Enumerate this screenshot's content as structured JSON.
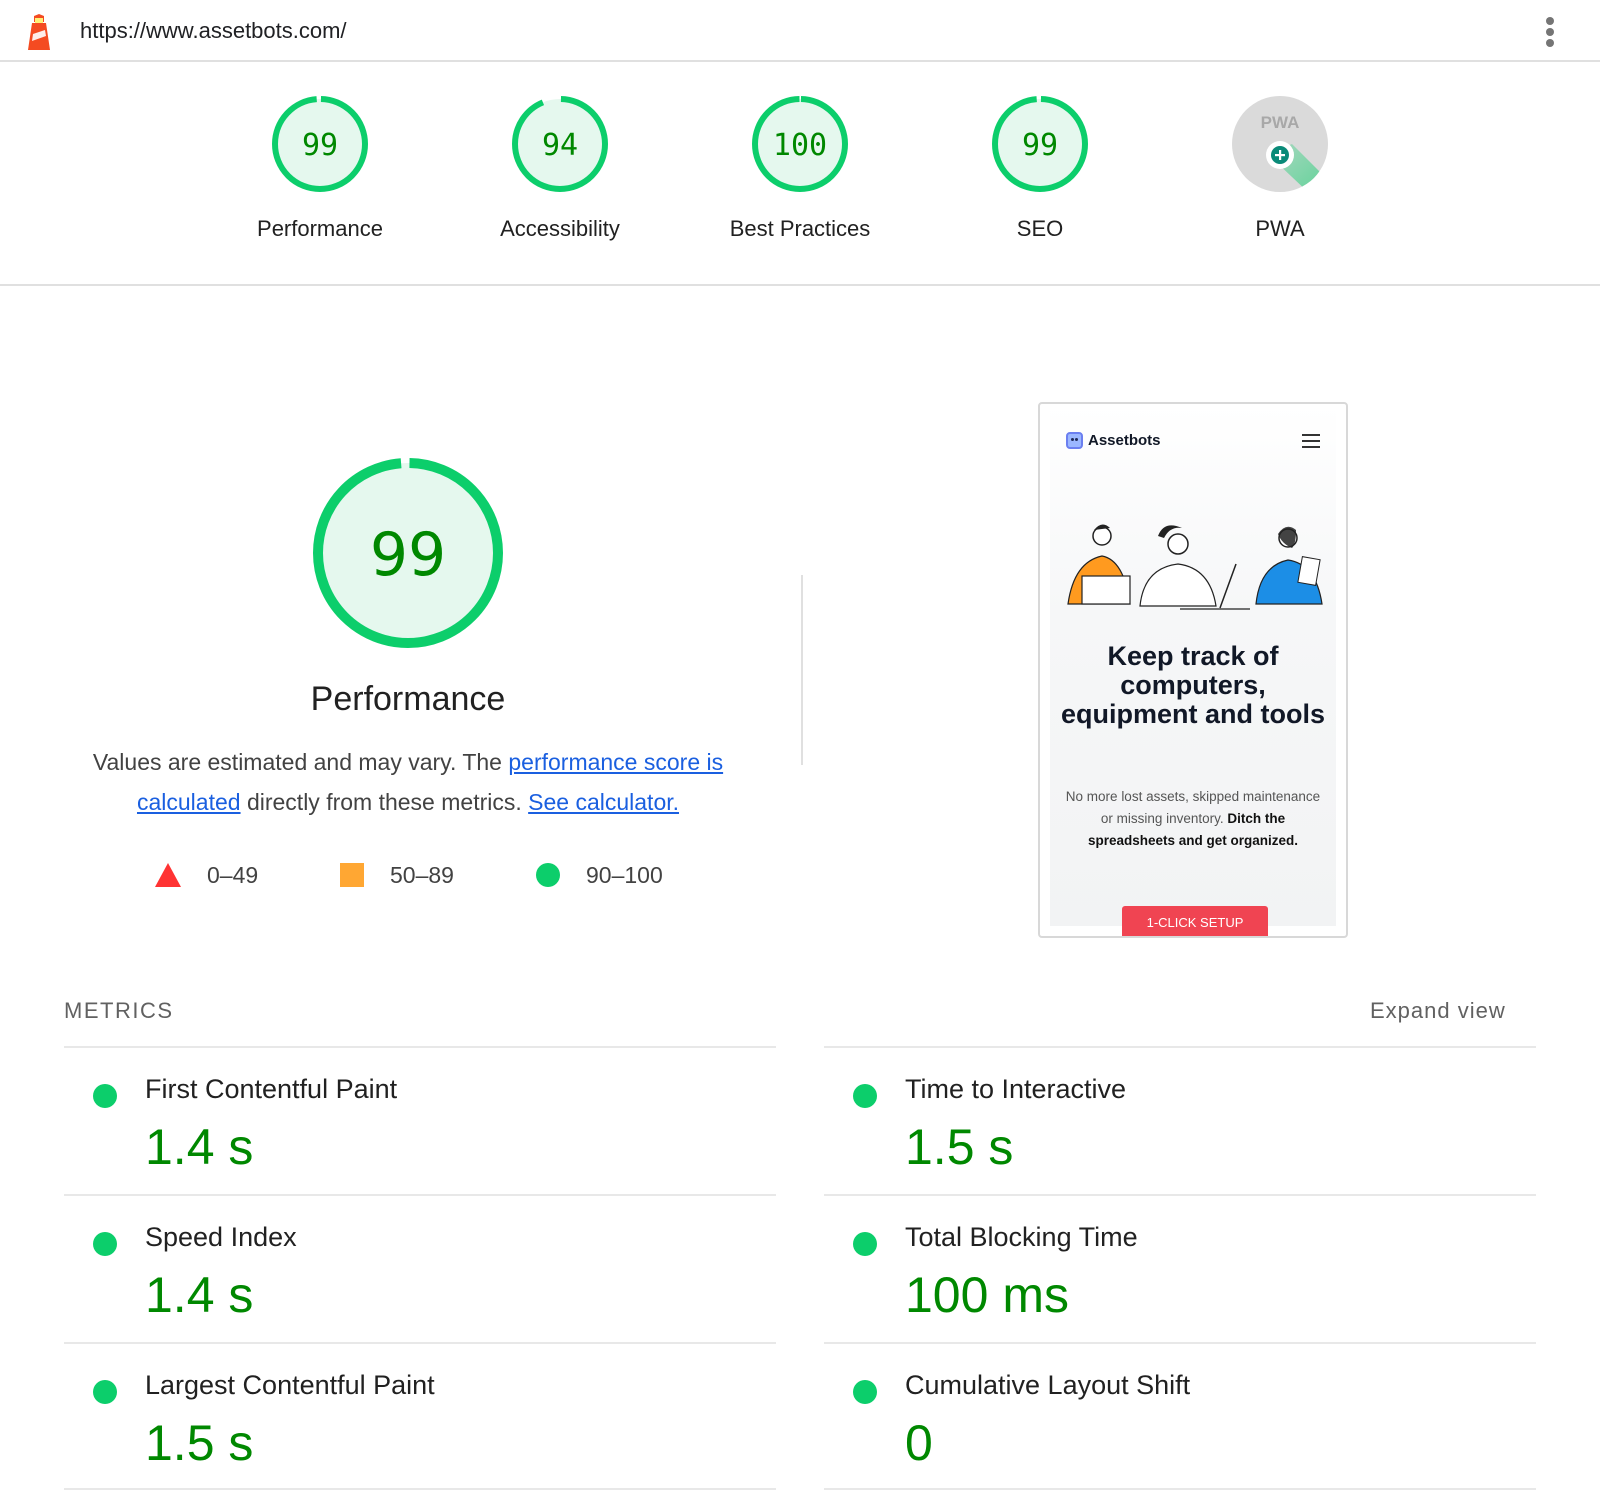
{
  "header": {
    "url": "https://www.assetbots.com/",
    "logo_icon": "lighthouse-icon",
    "menu_icon": "kebab-menu-icon"
  },
  "gauges": [
    {
      "label": "Performance",
      "score": "99",
      "value": 99
    },
    {
      "label": "Accessibility",
      "score": "94",
      "value": 94
    },
    {
      "label": "Best Practices",
      "score": "100",
      "value": 100
    },
    {
      "label": "SEO",
      "score": "99",
      "value": 99
    },
    {
      "label": "PWA",
      "badge_text": "PWA",
      "icon": "pwa-badge-icon"
    }
  ],
  "performance": {
    "score": "99",
    "value": 99,
    "title": "Performance",
    "desc_prefix": "Values are estimated and may vary. The ",
    "link1": "performance score is calculated",
    "desc_mid": " directly from these metrics. ",
    "link2": "See calculator.",
    "legend": [
      {
        "range": "0–49",
        "shape": "triangle",
        "color": "#ff3333"
      },
      {
        "range": "50–89",
        "shape": "square",
        "color": "#ffa733"
      },
      {
        "range": "90–100",
        "shape": "circle",
        "color": "#0cce6b"
      }
    ]
  },
  "screenshot": {
    "brand": "Assetbots",
    "headline": "Keep track of computers, equipment and tools",
    "body_normal": "No more lost assets, skipped maintenance or missing inventory.",
    "body_bold": "Ditch the spreadsheets and get organized.",
    "cta": "1-CLICK SETUP"
  },
  "metrics": {
    "heading": "METRICS",
    "expand_label": "Expand view",
    "items": [
      {
        "name": "First Contentful Paint",
        "value": "1.4 s",
        "status": "pass"
      },
      {
        "name": "Time to Interactive",
        "value": "1.5 s",
        "status": "pass"
      },
      {
        "name": "Speed Index",
        "value": "1.4 s",
        "status": "pass"
      },
      {
        "name": "Total Blocking Time",
        "value": "100 ms",
        "status": "pass"
      },
      {
        "name": "Largest Contentful Paint",
        "value": "1.5 s",
        "status": "pass"
      },
      {
        "name": "Cumulative Layout Shift",
        "value": "0",
        "status": "pass"
      }
    ]
  },
  "colors": {
    "pass": "#0cce6b",
    "pass_text": "#008800",
    "average": "#ffa733",
    "fail": "#ff3333",
    "link": "#1a5fe0"
  }
}
